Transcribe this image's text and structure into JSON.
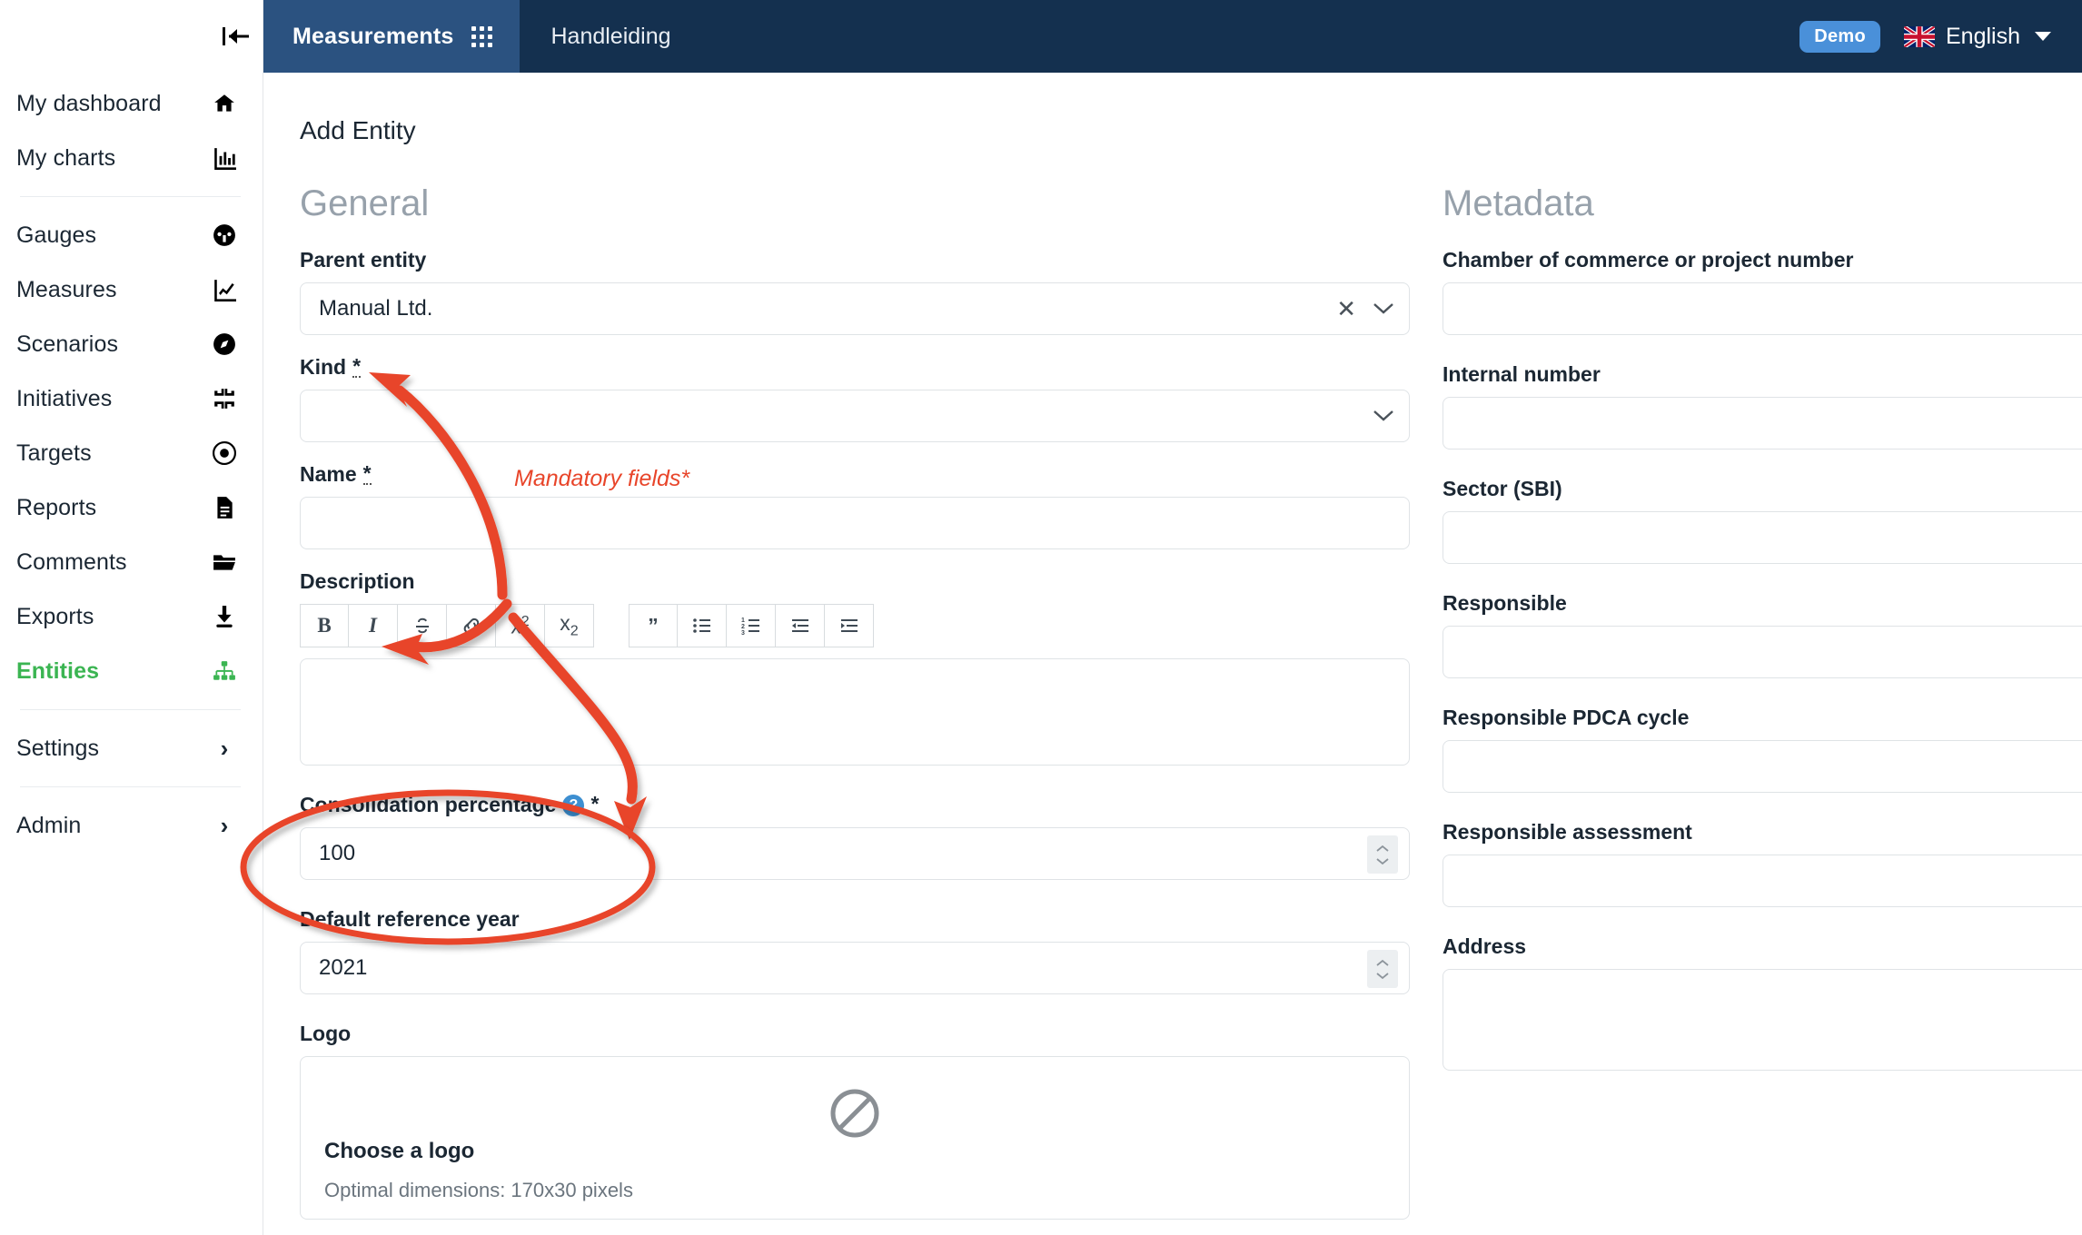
{
  "colors": {
    "header_dark": "#14304f",
    "tab_active": "#2b5280",
    "accent_green": "#3bb552",
    "annotation_red": "#e8452a",
    "badge_blue": "#4a90d9",
    "help_blue": "#3d8fd1"
  },
  "topbar": {
    "app_tab": "Measurements",
    "secondary_tab": "Handleiding",
    "demo_badge": "Demo",
    "language": "English"
  },
  "sidebar": {
    "items": [
      {
        "label": "My dashboard",
        "icon": "home-icon",
        "active": false
      },
      {
        "label": "My charts",
        "icon": "bar-chart-icon",
        "active": false
      },
      {
        "label": "Gauges",
        "icon": "gauge-icon",
        "active": false
      },
      {
        "label": "Measures",
        "icon": "line-chart-icon",
        "active": false
      },
      {
        "label": "Scenarios",
        "icon": "compass-icon",
        "active": false
      },
      {
        "label": "Initiatives",
        "icon": "collapse-arrows-icon",
        "active": false
      },
      {
        "label": "Targets",
        "icon": "target-icon",
        "active": false
      },
      {
        "label": "Reports",
        "icon": "document-icon",
        "active": false
      },
      {
        "label": "Comments",
        "icon": "folder-icon",
        "active": false
      },
      {
        "label": "Exports",
        "icon": "download-icon",
        "active": false
      },
      {
        "label": "Entities",
        "icon": "sitemap-icon",
        "active": true
      },
      {
        "label": "Settings",
        "icon": "chevron-right-icon",
        "active": false
      },
      {
        "label": "Admin",
        "icon": "chevron-right-icon",
        "active": false
      }
    ]
  },
  "page": {
    "title": "Add Entity"
  },
  "general": {
    "section_title": "General",
    "parent_entity": {
      "label": "Parent entity",
      "value": "Manual Ltd.",
      "placeholder": ""
    },
    "kind": {
      "label": "Kind",
      "required_marker": "*",
      "value": "",
      "placeholder": ""
    },
    "name": {
      "label": "Name",
      "required_marker": "*",
      "value": "",
      "placeholder": ""
    },
    "description": {
      "label": "Description",
      "value": "",
      "toolbar_group_1": [
        {
          "label": "B",
          "name": "bold-icon"
        },
        {
          "label": "I",
          "name": "italic-icon"
        },
        {
          "label": "S",
          "name": "strikethrough-icon"
        },
        {
          "label": "link",
          "name": "link-icon"
        },
        {
          "label": "x2",
          "name": "superscript-icon"
        },
        {
          "label": "x2sub",
          "name": "subscript-icon"
        }
      ],
      "toolbar_group_2": [
        {
          "label": "quote",
          "name": "blockquote-icon"
        },
        {
          "label": "ul",
          "name": "bullet-list-icon"
        },
        {
          "label": "ol",
          "name": "numbered-list-icon"
        },
        {
          "label": "outdent",
          "name": "outdent-icon"
        },
        {
          "label": "indent",
          "name": "indent-icon"
        }
      ]
    },
    "consolidation": {
      "label": "Consolidation percentage",
      "help": "?",
      "required_marker": "*",
      "value": "100"
    },
    "reference_year": {
      "label": "Default reference year",
      "value": "2021"
    },
    "logo": {
      "label": "Logo",
      "choose_title": "Choose a logo",
      "hint": "Optimal dimensions: 170x30 pixels"
    }
  },
  "metadata": {
    "section_title": "Metadata",
    "fields": [
      {
        "label": "Chamber of commerce or project number",
        "value": "",
        "type": "text"
      },
      {
        "label": "Internal number",
        "value": "",
        "type": "text"
      },
      {
        "label": "Sector (SBI)",
        "value": "",
        "type": "text"
      },
      {
        "label": "Responsible",
        "value": "",
        "type": "text"
      },
      {
        "label": "Responsible PDCA cycle",
        "value": "",
        "type": "text"
      },
      {
        "label": "Responsible assessment",
        "value": "",
        "type": "text"
      },
      {
        "label": "Address",
        "value": "",
        "type": "textarea"
      }
    ]
  },
  "annotations": {
    "mandatory_note": "Mandatory fields*"
  }
}
